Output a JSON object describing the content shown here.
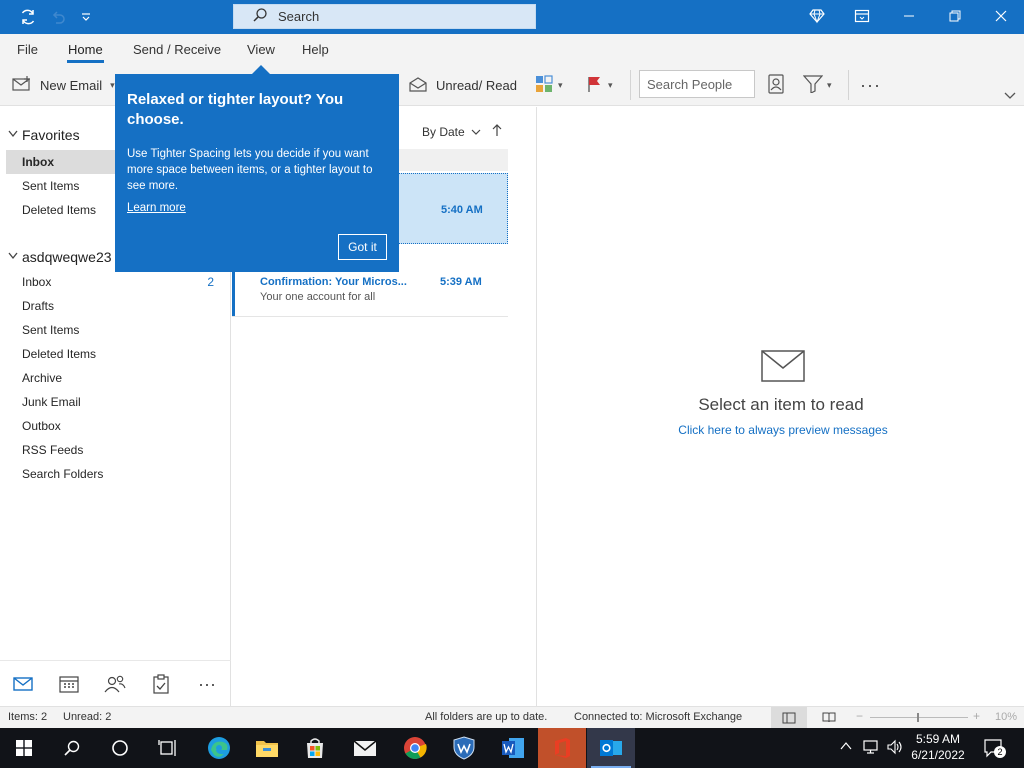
{
  "titlebar": {
    "search_placeholder": "Search"
  },
  "menu": {
    "file": "File",
    "home": "Home",
    "send_receive": "Send / Receive",
    "view": "View",
    "help": "Help"
  },
  "ribbon": {
    "new_email": "New Email",
    "unread_read": "Unread/ Read",
    "search_people": "Search People"
  },
  "callout": {
    "title": "Relaxed or tighter layout? You choose.",
    "body": "Use Tighter Spacing lets you decide if you want more space between items, or a tighter layout to see more.",
    "learn_more": "Learn more",
    "got_it": "Got it"
  },
  "nav": {
    "favorites_header": "Favorites",
    "favorites": [
      {
        "label": "Inbox",
        "selected": true
      },
      {
        "label": "Sent Items"
      },
      {
        "label": "Deleted Items"
      }
    ],
    "account_header": "asdqweqwe23",
    "account_items": [
      {
        "label": "Inbox",
        "count": "2"
      },
      {
        "label": "Drafts"
      },
      {
        "label": "Sent Items"
      },
      {
        "label": "Deleted Items"
      },
      {
        "label": "Archive"
      },
      {
        "label": "Junk Email"
      },
      {
        "label": "Outbox"
      },
      {
        "label": "RSS Feeds"
      },
      {
        "label": "Search Folders"
      }
    ]
  },
  "list": {
    "sort_label": "By Date",
    "messages": [
      {
        "time": "5:40 AM",
        "selected": true
      },
      {
        "subject": "Confirmation: Your Micros...",
        "preview": "Your one account for all",
        "time": "5:39 AM"
      }
    ]
  },
  "reading": {
    "empty_title": "Select an item to read",
    "preview_link": "Click here to always preview messages"
  },
  "status": {
    "items": "Items: 2",
    "unread": "Unread: 2",
    "sync": "All folders are up to date.",
    "connection": "Connected to: Microsoft Exchange",
    "zoom": "10%"
  },
  "taskbar": {
    "time": "5:59 AM",
    "date": "6/21/2022",
    "notifications": "2"
  },
  "colors": {
    "accent": "#1570c4",
    "selected_message": "#cce4f7"
  }
}
